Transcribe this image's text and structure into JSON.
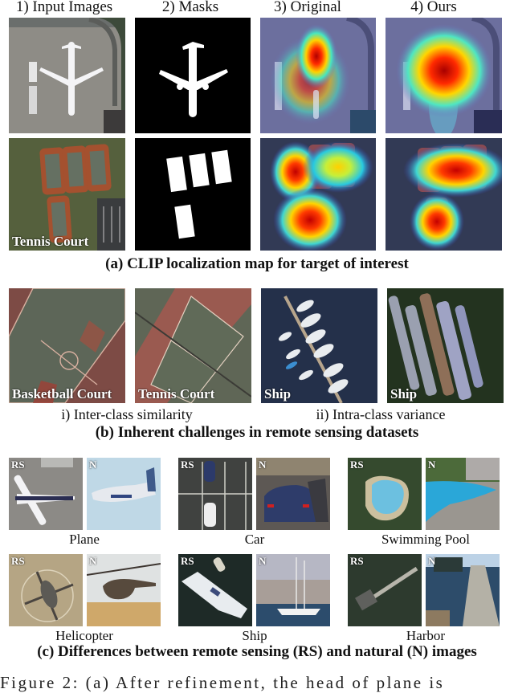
{
  "panel_a": {
    "column_headers": [
      "1) Input Images",
      "2) Masks",
      "3) Original",
      "4) Ours"
    ],
    "row2_overlay_label": "Tennis Court",
    "caption": "(a)  CLIP localization map for target of interest"
  },
  "panel_b": {
    "images": [
      {
        "label": "Basketball Court",
        "kind": "court-basketball"
      },
      {
        "label": "Tennis Court",
        "kind": "court-tennis"
      },
      {
        "label": "Ship",
        "kind": "marina"
      },
      {
        "label": "Ship",
        "kind": "barges"
      }
    ],
    "sub_labels": [
      "i) Inter-class similarity",
      "ii) Intra-class variance"
    ],
    "caption": "(b) Inherent challenges in remote sensing datasets"
  },
  "panel_c": {
    "rs_tag": "RS",
    "n_tag": "N",
    "pairs": [
      {
        "label": "Plane"
      },
      {
        "label": "Car"
      },
      {
        "label": "Swimming Pool"
      },
      {
        "label": "Helicopter"
      },
      {
        "label": "Ship"
      },
      {
        "label": "Harbor"
      }
    ],
    "caption": "(c) Differences between remote sensing (RS) and natural (N) images"
  },
  "figure_caption_partial": "Figure 2: (a) After refinement, the head of plane is"
}
